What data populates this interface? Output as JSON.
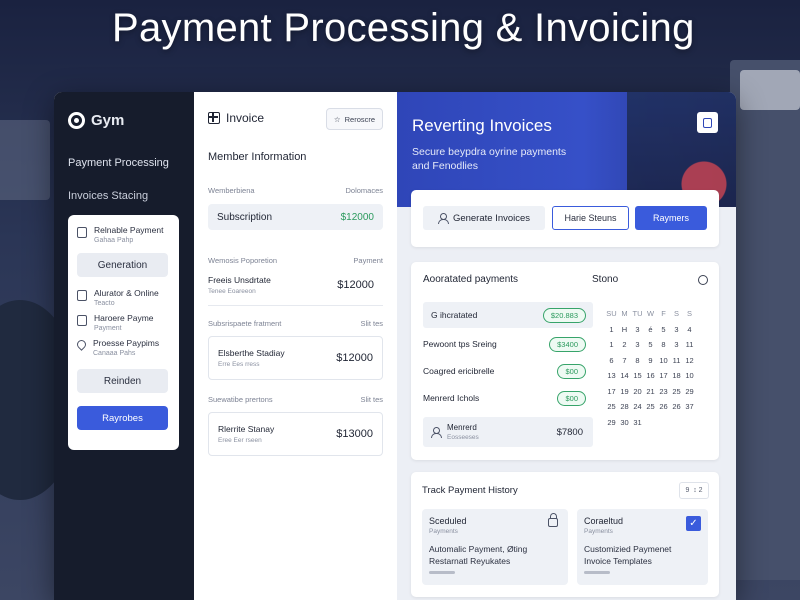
{
  "headline": "Payment Processing & Invoicing",
  "sidebar": {
    "brand": "Gym",
    "nav": [
      "Payment Processing",
      "Invoices Stacing"
    ],
    "card": {
      "top_item": {
        "title": "Relnable Payment",
        "sub": "Gahaa Pahp"
      },
      "generation_label": "Generation",
      "items": [
        {
          "title": "Alurator & Online",
          "sub": "Teacto"
        },
        {
          "title": "Haroere Payme",
          "sub": "Payment"
        },
        {
          "title": "Proesse Paypims",
          "sub": "Canaaa Pahs"
        }
      ],
      "reinden_label": "Reinden",
      "primary_label": "Rayrobes"
    }
  },
  "middle": {
    "header_title": "Invoice",
    "header_button": "Reroscre",
    "section_title": "Member Information",
    "member_row": {
      "left": "Wemberbiena",
      "right": "Dolomaces"
    },
    "subscription": {
      "label": "Subscription",
      "value": "$12000"
    },
    "pop_row": {
      "left": "Wemosis Poporetion",
      "right": "Payment"
    },
    "feets_row": {
      "title": "Freeis Unsdrtate",
      "sub": "Tenee Eoareeon",
      "value": "$12000"
    },
    "sub_row1": {
      "left": "Subsrispaete fratment",
      "right": "Slit tes"
    },
    "box1": {
      "title": "Elsberthe Stadiay",
      "sub": "Erre Ees rress",
      "value": "$12000"
    },
    "sub_row2": {
      "left": "Suewatibe prertons",
      "right": "Slit tes"
    },
    "box2": {
      "title": "Rlerrite Stanay",
      "sub": "Eree Eer rseen",
      "value": "$13000"
    }
  },
  "right": {
    "hero": {
      "title": "Reverting Invoices",
      "sub": "Secure beypdra oyrine payments and Fenodlies"
    },
    "actions": {
      "generate": "Generate Invoices",
      "status": "Harie Steuns",
      "primary": "Raymers"
    },
    "payments": {
      "title": "Aooratated payments",
      "store": "Stono",
      "rows": [
        {
          "label": "G ihcratated",
          "amount": "$20.883"
        },
        {
          "label": "Pewoont tps Sreing",
          "amount": "$3400"
        },
        {
          "label": "Coagred ericibrelle",
          "amount": "$00"
        },
        {
          "label": "Menrerd Ichols",
          "amount": "$00"
        }
      ],
      "total": {
        "title": "Menrerd",
        "sub": "Eosseeses",
        "value": "$7800"
      }
    },
    "calendar": {
      "days": [
        "SU",
        "M",
        "TU",
        "W",
        "F",
        "S",
        "S"
      ],
      "weeks": [
        [
          "1",
          "H",
          "3",
          "é",
          "5",
          "3",
          "4"
        ],
        [
          "1",
          "2",
          "3",
          "5",
          "8",
          "3",
          "11"
        ],
        [
          "6",
          "7",
          "8",
          "9",
          "10",
          "11",
          "12"
        ],
        [
          "13",
          "14",
          "15",
          "16",
          "17",
          "18",
          "10"
        ],
        [
          "17",
          "19",
          "20",
          "21",
          "23",
          "25",
          "29"
        ],
        [
          "25",
          "28",
          "24",
          "25",
          "26",
          "26",
          "37"
        ],
        [
          "29",
          "30",
          "31",
          "",
          "",
          "",
          ""
        ]
      ]
    },
    "track": {
      "title": "Track Payment History",
      "control": "9  ↕ 2",
      "scheduled": {
        "title": "Sceduled",
        "sub": "Payments",
        "line1": "Automalic Payment, Øting",
        "line2": "Restarnatl Reyukates"
      },
      "completed": {
        "title": "Coraeltud",
        "sub": "Payments",
        "line1": "Customizied Paymenet",
        "line2": "Invoice Templates"
      }
    }
  }
}
